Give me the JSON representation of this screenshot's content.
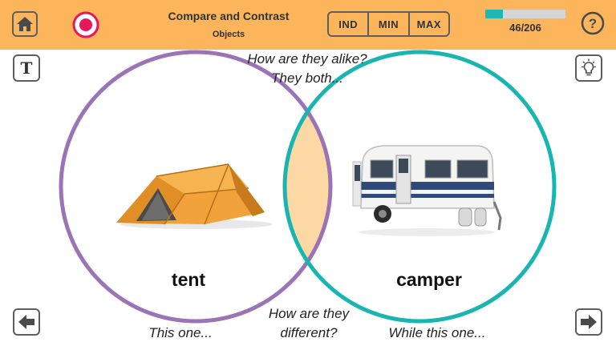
{
  "header": {
    "title": "Compare and Contrast",
    "subtitle": "Objects",
    "levels": [
      "IND",
      "MIN",
      "MAX"
    ],
    "progress": {
      "current": 46,
      "total": 206,
      "text": "46/206"
    },
    "help_label": "?"
  },
  "toolbar": {
    "text_button_label": "T"
  },
  "prompts": {
    "alike_line1": "How are they alike?",
    "alike_line2": "They both...",
    "different_line1": "How are they",
    "different_line2": "different?",
    "left_sentence": "This one...",
    "right_sentence": "While this one..."
  },
  "items": {
    "left_word": "tent",
    "right_word": "camper"
  },
  "colors": {
    "header_bg": "#FCB55A",
    "left_circle": "#9B74B5",
    "right_circle": "#19B5B1",
    "overlap": "#FCD9A4",
    "record": "#E8175D",
    "progress_fill": "#1FB7B3"
  },
  "icons": [
    "home-icon",
    "record-icon",
    "help-icon",
    "text-icon",
    "lightbulb-icon",
    "arrow-left-icon",
    "arrow-right-icon"
  ]
}
